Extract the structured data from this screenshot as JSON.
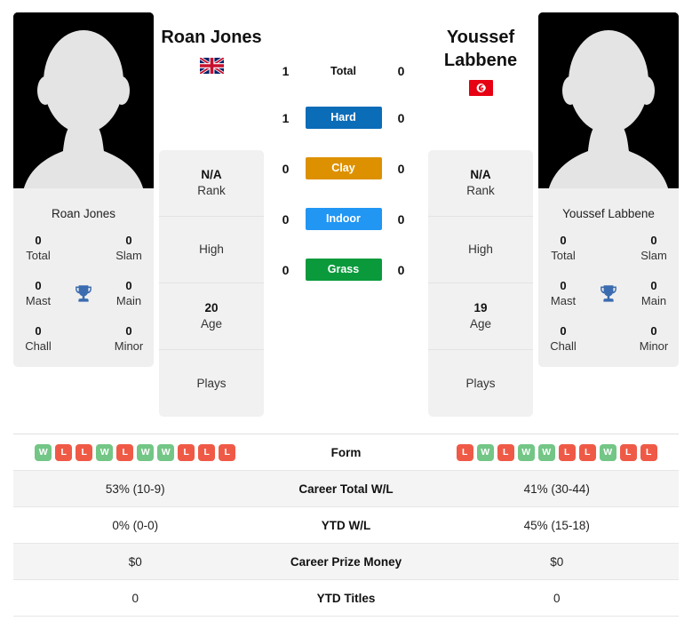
{
  "players": {
    "left": {
      "name": "Roan Jones",
      "card_name": "Roan Jones",
      "country": "Great Britain",
      "flag": "gb-flag-icon",
      "rank": "N/A",
      "rank_label": "Rank",
      "high_label": "High",
      "high_value": "",
      "age": "20",
      "age_label": "Age",
      "plays_label": "Plays",
      "plays_value": "",
      "titles": {
        "total": "0",
        "total_label": "Total",
        "slam": "0",
        "slam_label": "Slam",
        "mast": "0",
        "mast_label": "Mast",
        "main": "0",
        "main_label": "Main",
        "chall": "0",
        "chall_label": "Chall",
        "minor": "0",
        "minor_label": "Minor"
      },
      "form": [
        "W",
        "L",
        "L",
        "W",
        "L",
        "W",
        "W",
        "L",
        "L",
        "L"
      ],
      "career_wl": "53% (10-9)",
      "ytd_wl": "0% (0-0)",
      "career_prize": "$0",
      "ytd_titles": "0"
    },
    "right": {
      "name": "Youssef Labbene",
      "card_name": "Youssef Labbene",
      "country": "Tunisia",
      "flag": "tn-flag-icon",
      "rank": "N/A",
      "rank_label": "Rank",
      "high_label": "High",
      "high_value": "",
      "age": "19",
      "age_label": "Age",
      "plays_label": "Plays",
      "plays_value": "",
      "titles": {
        "total": "0",
        "total_label": "Total",
        "slam": "0",
        "slam_label": "Slam",
        "mast": "0",
        "mast_label": "Mast",
        "main": "0",
        "main_label": "Main",
        "chall": "0",
        "chall_label": "Chall",
        "minor": "0",
        "minor_label": "Minor"
      },
      "form": [
        "L",
        "W",
        "L",
        "W",
        "W",
        "L",
        "L",
        "W",
        "L",
        "L"
      ],
      "career_wl": "41% (30-44)",
      "ytd_wl": "45% (15-18)",
      "career_prize": "$0",
      "ytd_titles": "0"
    }
  },
  "h2h": {
    "rows": [
      {
        "label": "Total",
        "left": "1",
        "right": "0",
        "color": "",
        "bar": false
      },
      {
        "label": "Hard",
        "left": "1",
        "right": "0",
        "color": "#0b6cb8",
        "bar": true
      },
      {
        "label": "Clay",
        "left": "0",
        "right": "0",
        "color": "#dd9100",
        "bar": true
      },
      {
        "label": "Indoor",
        "left": "0",
        "right": "0",
        "color": "#2196f3",
        "bar": true
      },
      {
        "label": "Grass",
        "left": "0",
        "right": "0",
        "color": "#0a9a3c",
        "bar": true
      }
    ]
  },
  "table": {
    "rows": [
      {
        "label": "Form",
        "type": "form"
      },
      {
        "label": "Career Total W/L",
        "type": "text",
        "left": "53% (10-9)",
        "right": "41% (30-44)"
      },
      {
        "label": "YTD W/L",
        "type": "text",
        "left": "0% (0-0)",
        "right": "45% (15-18)"
      },
      {
        "label": "Career Prize Money",
        "type": "text",
        "left": "$0",
        "right": "$0"
      },
      {
        "label": "YTD Titles",
        "type": "text",
        "left": "0",
        "right": "0"
      }
    ]
  },
  "colors": {
    "hard": "#0b6cb8",
    "clay": "#dd9100",
    "indoor": "#2196f3",
    "grass": "#0a9a3c",
    "win": "#73c686",
    "loss": "#ef5a47",
    "trophy": "#3b6cb0"
  },
  "icons": {
    "trophy": "trophy-icon",
    "silhouette": "person-silhouette-icon"
  }
}
